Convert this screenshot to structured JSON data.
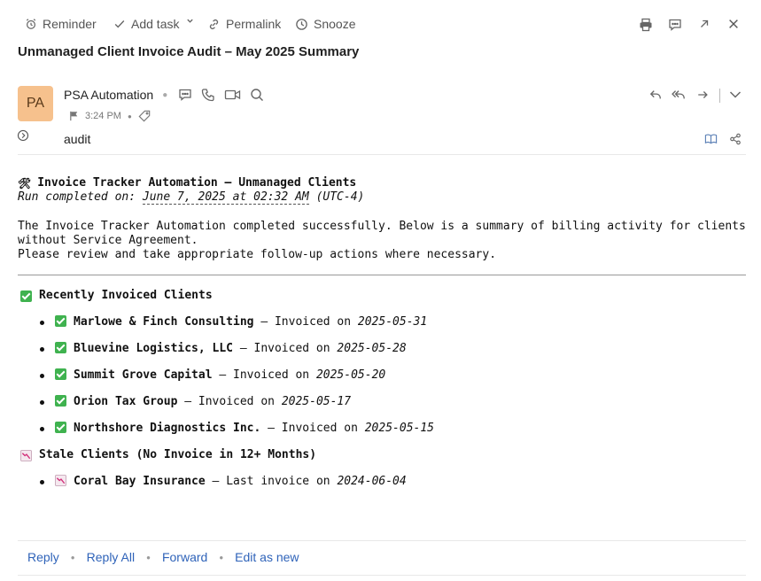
{
  "toolbar": {
    "reminder": "Reminder",
    "add_task": "Add task",
    "permalink": "Permalink",
    "snooze": "Snooze"
  },
  "subject": "Unmanaged Client Invoice Audit – May 2025 Summary",
  "sender": {
    "initials": "PA",
    "name": "PSA Automation",
    "time": "3:24 PM",
    "tag": "audit",
    "avatar_color": "#f6c18d"
  },
  "body": {
    "title_icon": "🛠",
    "title": "Invoice Tracker Automation – Unmanaged Clients",
    "run_prefix": "Run completed on:",
    "run_date": "June 7, 2025 at 02:32 AM",
    "run_tz": "(UTC-4)",
    "desc_line1": "The Invoice Tracker Automation completed successfully. Below is a summary of billing activity for clients without Service Agreement.",
    "desc_line2": "Please review and take appropriate follow-up actions where necessary.",
    "invoiced_title": "Recently Invoiced Clients",
    "invoiced": [
      {
        "name": "Marlowe & Finch Consulting",
        "label": " – Invoiced on ",
        "date": "2025-05-31"
      },
      {
        "name": "Bluevine Logistics, LLC",
        "label": " – Invoiced on ",
        "date": "2025-05-28"
      },
      {
        "name": "Summit Grove Capital",
        "label": " – Invoiced on ",
        "date": "2025-05-20"
      },
      {
        "name": "Orion Tax Group",
        "label": " – Invoiced on ",
        "date": "2025-05-17"
      },
      {
        "name": "Northshore Diagnostics Inc.",
        "label": " – Invoiced on ",
        "date": "2025-05-15"
      }
    ],
    "stale_title": "Stale Clients (No Invoice in 12+ Months)",
    "stale": [
      {
        "name": "Coral Bay Insurance",
        "label": " – Last invoice on ",
        "date": "2024-06-04"
      }
    ]
  },
  "footer": {
    "reply": "Reply",
    "reply_all": "Reply All",
    "forward": "Forward",
    "edit_as_new": "Edit as new"
  },
  "colors": {
    "link": "#2f63b9",
    "check": "#3fb24f"
  }
}
